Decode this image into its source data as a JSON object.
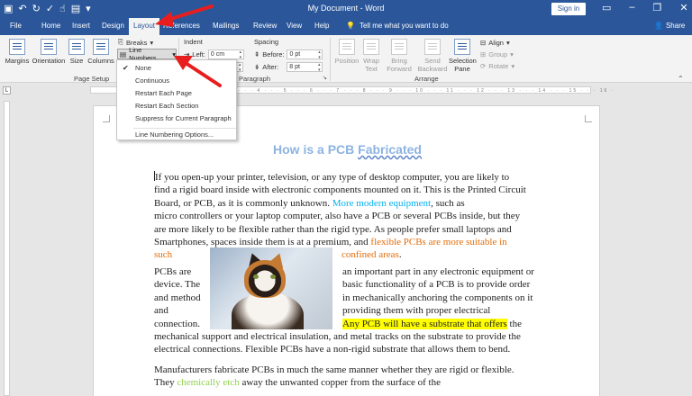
{
  "titlebar": {
    "title": "My Document  -  Word",
    "signin": "Sign in",
    "qat_icons": [
      "save-icon",
      "undo-icon",
      "redo-icon",
      "spelling-icon",
      "touch-mode-icon",
      "open-icon",
      "customize-icon"
    ]
  },
  "tabs": [
    {
      "label": "File"
    },
    {
      "label": "Home"
    },
    {
      "label": "Insert"
    },
    {
      "label": "Design"
    },
    {
      "label": "Layout"
    },
    {
      "label": "References"
    },
    {
      "label": "Mailings"
    },
    {
      "label": "Review"
    },
    {
      "label": "View"
    },
    {
      "label": "Help"
    }
  ],
  "tellme": "Tell me what you want to do",
  "share": "Share",
  "ribbon": {
    "page_setup": {
      "margins": "Margins",
      "orientation": "Orientation",
      "size": "Size",
      "columns": "Columns",
      "breaks": "Breaks",
      "line_numbers": "Line Numbers",
      "label": "Page Setup"
    },
    "paragraph": {
      "indent": "Indent",
      "left_label": "Left:",
      "left_value": "0 cm",
      "right_value": "0 cm",
      "spacing": "Spacing",
      "before_label": "Before:",
      "before_value": "0 pt",
      "after_label": "After:",
      "after_value": "8 pt",
      "label": "Paragraph"
    },
    "arrange": {
      "position": "Position",
      "wrap": "Wrap",
      "text": "Text",
      "bring": "Bring",
      "forward": "Forward",
      "send": "Send",
      "backward": "Backward",
      "selection": "Selection",
      "pane": "Pane",
      "align": "Align",
      "group": "Group",
      "rotate": "Rotate",
      "label": "Arrange"
    }
  },
  "dropdown": {
    "items": [
      {
        "label": "None",
        "checked": true
      },
      {
        "label": "Continuous"
      },
      {
        "label": "Restart Each Page"
      },
      {
        "label": "Restart Each Section"
      },
      {
        "label": "Suppress for Current Paragraph"
      },
      {
        "label": "Line Numbering Options..."
      }
    ]
  },
  "document": {
    "title_a": "How is a PCB ",
    "title_b": "Fabricated",
    "p1_a": "If you open-up your printer, television, or any type of desktop computer, you are likely to",
    "p1_b": "find a rigid board inside with electronic components mounted on it. This is the Printed Circuit",
    "p1_c1": "Board, or PCB, as it is commonly unknown. ",
    "p1_c2": "More modern equipment",
    "p1_c3": ", such as",
    "p1_d": "micro controllers or your laptop computer, also have a PCB or several PCBs inside, but they",
    "p1_e": "are more likely to be flexible rather than the rigid type. As people prefer small laptops and",
    "p1_f1": "Smartphones, spaces inside them is at a premium, and ",
    "p1_f2": "flexible PCBs are more suitable in",
    "p1_g1": "such",
    "p1_g2": "confined areas",
    "p1_g3": ".",
    "p2_left": [
      "PCBs are",
      "device. The",
      "and method",
      "and",
      "connection."
    ],
    "p2_right": [
      "an important part in any electronic equipment or",
      "basic functionality of a PCB is to provide order",
      "in mechanically anchoring the components on it",
      "providing them with proper electrical",
      "Any PCB will have a substrate that offers",
      " the"
    ],
    "p2_f": "mechanical support and electrical insulation, and metal tracks on the substrate to provide the",
    "p2_g": "electrical connections. Flexible PCBs have a non-rigid substrate that allows them to bend.",
    "p3_a": "Manufacturers fabricate PCBs in much the same manner whether they are rigid or flexible.",
    "p3_b1": "They ",
    "p3_b2": "chemically etch",
    "p3_b3": " away the unwanted copper from the surface of the"
  },
  "colors": {
    "word_blue": "#2b579a",
    "title_blue": "#8db3e2",
    "cyan": "#00b0f0",
    "orange": "#e36c09",
    "green": "#92d050",
    "highlight": "#ffff00",
    "arrow_red": "#e81e1e"
  }
}
